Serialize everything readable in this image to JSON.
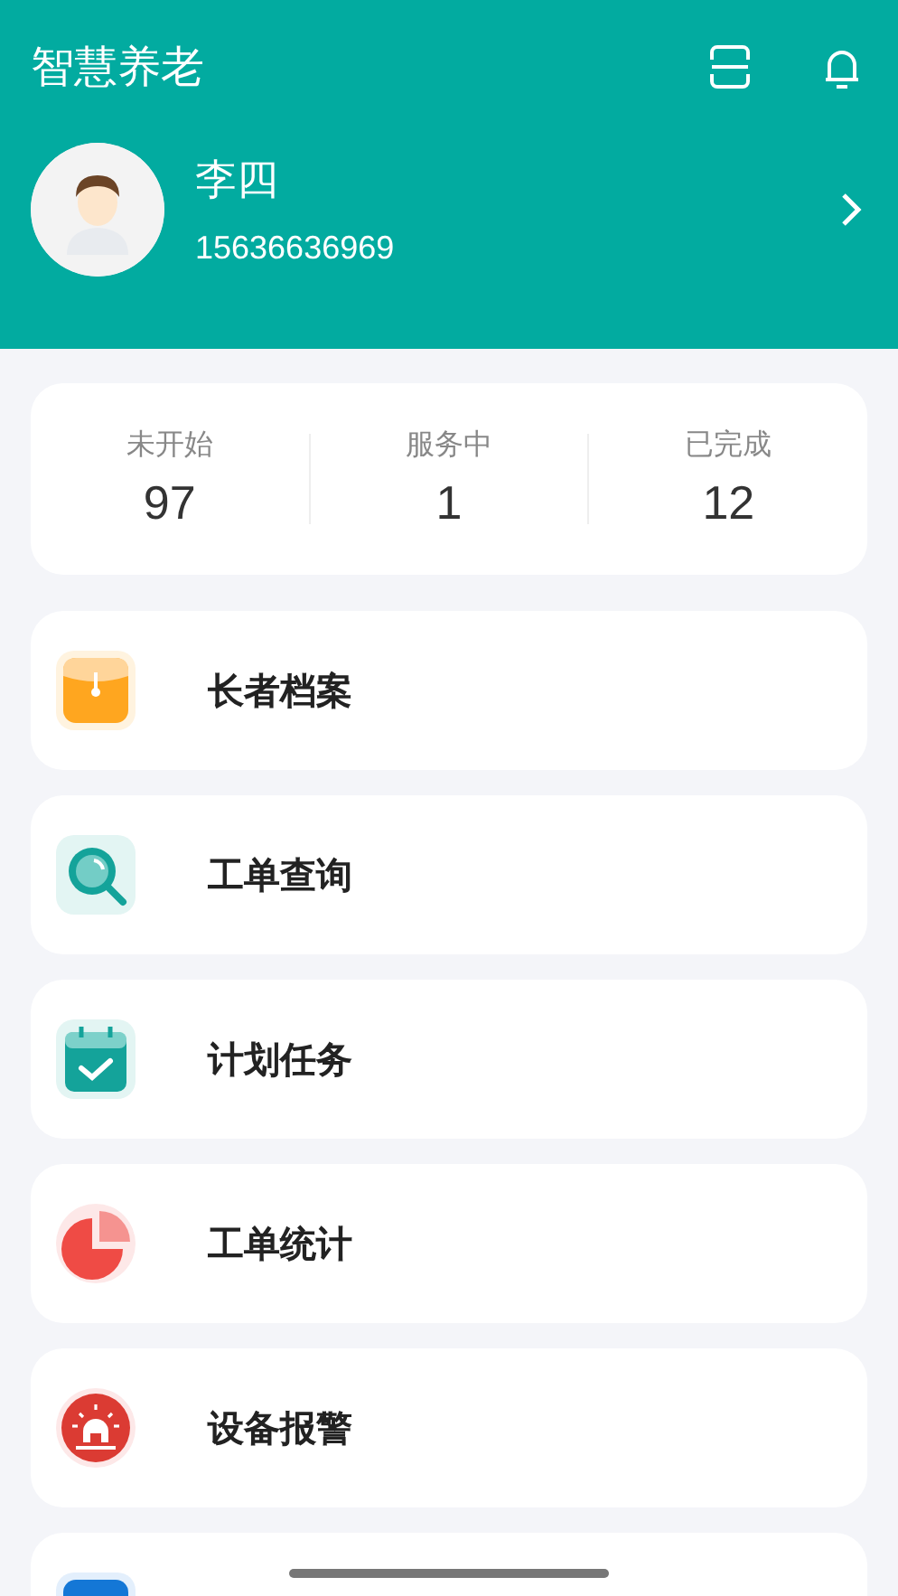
{
  "header": {
    "title": "智慧养老"
  },
  "profile": {
    "name": "李四",
    "phone": "15636636969"
  },
  "stats": [
    {
      "label": "未开始",
      "value": "97"
    },
    {
      "label": "服务中",
      "value": "1"
    },
    {
      "label": "已完成",
      "value": "12"
    }
  ],
  "menu": [
    {
      "kind": "folder",
      "label": "长者档案"
    },
    {
      "kind": "search",
      "label": "工单查询"
    },
    {
      "kind": "calendar",
      "label": "计划任务"
    },
    {
      "kind": "pie",
      "label": "工单统计"
    },
    {
      "kind": "alarm",
      "label": "设备报警"
    },
    {
      "kind": "blue"
    }
  ]
}
